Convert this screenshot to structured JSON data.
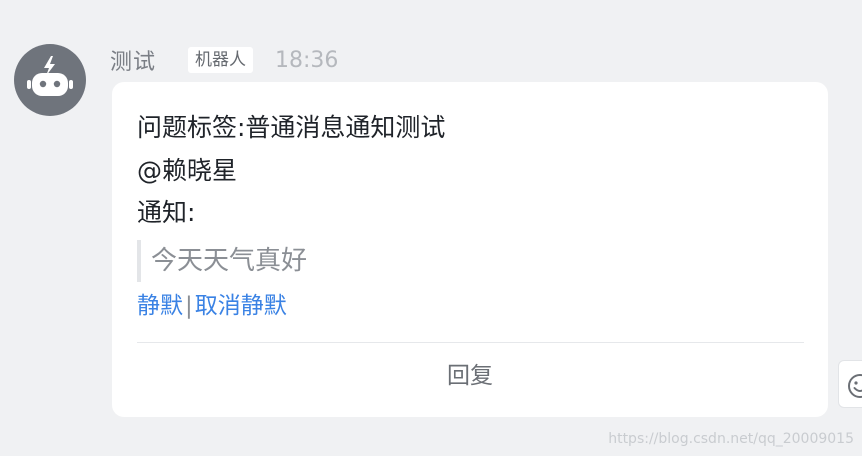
{
  "message": {
    "sender": "测试",
    "badge": "机器人",
    "time": "18:36",
    "lines": [
      "问题标签:普通消息通知测试",
      "@赖晓星",
      "通知:"
    ],
    "quote": "今天天气真好",
    "actions": {
      "mute": "静默",
      "separator": "|",
      "unmute": "取消静默"
    },
    "reply_label": "回复"
  },
  "watermark": "https://blog.csdn.net/qq_20009015",
  "icons": {
    "avatar": "robot-icon",
    "emoji": "emoji-icon"
  },
  "colors": {
    "link": "#3a82e4",
    "background": "#f0f1f3",
    "bubble": "#ffffff",
    "avatar": "#6f747c"
  }
}
